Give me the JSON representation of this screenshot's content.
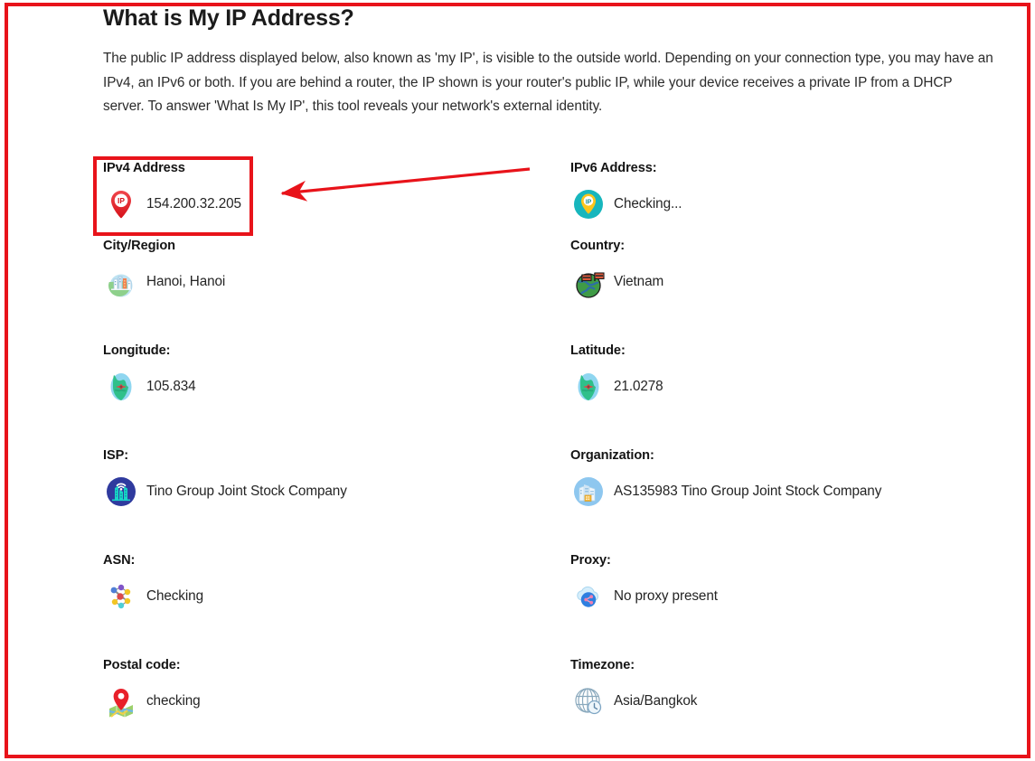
{
  "page": {
    "title": "What is My IP Address?",
    "intro": "The public IP address displayed below, also known as 'my IP', is visible to the outside world. Depending on your connection type, you may have an IPv4, an IPv6 or both. If you are behind a router, the IP shown is your router's public IP, while your device receives a private IP from a DHCP server. To answer 'What Is My IP', this tool reveals your network's external identity."
  },
  "annotations": {
    "highlight_color": "#e8131a",
    "arrow_color": "#e8131a",
    "frame_color": "#e8131a",
    "highlight_target": "IPv4 Address"
  },
  "fields": [
    {
      "label": "IPv4 Address",
      "value": "154.200.32.205",
      "icon": "ip-pin-red-icon",
      "name": "ipv4-address"
    },
    {
      "label": "IPv6 Address:",
      "value": "Checking...",
      "icon": "ip-pin-teal-icon",
      "name": "ipv6-address"
    },
    {
      "label": "City/Region",
      "value": "Hanoi, Hanoi",
      "icon": "city-globe-icon",
      "name": "city-region"
    },
    {
      "label": "Country:",
      "value": "Vietnam",
      "icon": "globe-flags-icon",
      "name": "country"
    },
    {
      "label": "Longitude:",
      "value": "105.834",
      "icon": "globe-compass-icon",
      "name": "longitude"
    },
    {
      "label": "Latitude:",
      "value": "21.0278",
      "icon": "globe-compass-icon",
      "name": "latitude"
    },
    {
      "label": "ISP:",
      "value": "Tino Group Joint Stock Company",
      "icon": "isp-wifi-buildings-icon",
      "name": "isp"
    },
    {
      "label": "Organization:",
      "value": "AS135983 Tino Group Joint Stock Company",
      "icon": "organization-buildings-icon",
      "name": "organization"
    },
    {
      "label": "ASN:",
      "value": "Checking",
      "icon": "network-nodes-icon",
      "name": "asn"
    },
    {
      "label": "Proxy:",
      "value": "No proxy present",
      "icon": "cloud-share-icon",
      "name": "proxy"
    },
    {
      "label": "Postal code:",
      "value": "checking",
      "icon": "map-pin-icon",
      "name": "postal-code"
    },
    {
      "label": "Timezone:",
      "value": "Asia/Bangkok",
      "icon": "globe-clock-icon",
      "name": "timezone"
    }
  ]
}
